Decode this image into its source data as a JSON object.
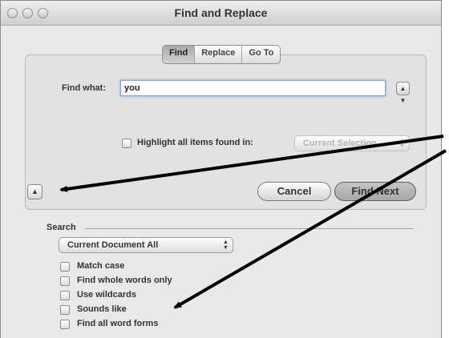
{
  "window": {
    "title": "Find and Replace"
  },
  "tabs": [
    {
      "label": "Find",
      "active": true
    },
    {
      "label": "Replace",
      "active": false
    },
    {
      "label": "Go To",
      "active": false
    }
  ],
  "find": {
    "label": "Find what:",
    "value": "you"
  },
  "highlight": {
    "label": "Highlight all items found in:",
    "scope": "Current Selection",
    "checked": false
  },
  "buttons": {
    "cancel": "Cancel",
    "find_next": "Find Next"
  },
  "search": {
    "header": "Search",
    "scope": "Current Document All",
    "options": [
      {
        "label": "Match case",
        "checked": false
      },
      {
        "label": "Find whole words only",
        "checked": false
      },
      {
        "label": "Use wildcards",
        "checked": false
      },
      {
        "label": "Sounds like",
        "checked": false
      },
      {
        "label": "Find all word forms",
        "checked": false
      }
    ]
  },
  "icons": {
    "expand_toggle": "triangle-up-icon",
    "stepper": "up-down-arrows-icon",
    "popup_arrow": "up-down-arrows-icon",
    "annotation": "arrow-icon"
  },
  "colors": {
    "focus_ring": "#6d9fdc",
    "annotation_arrow": "#000000"
  }
}
